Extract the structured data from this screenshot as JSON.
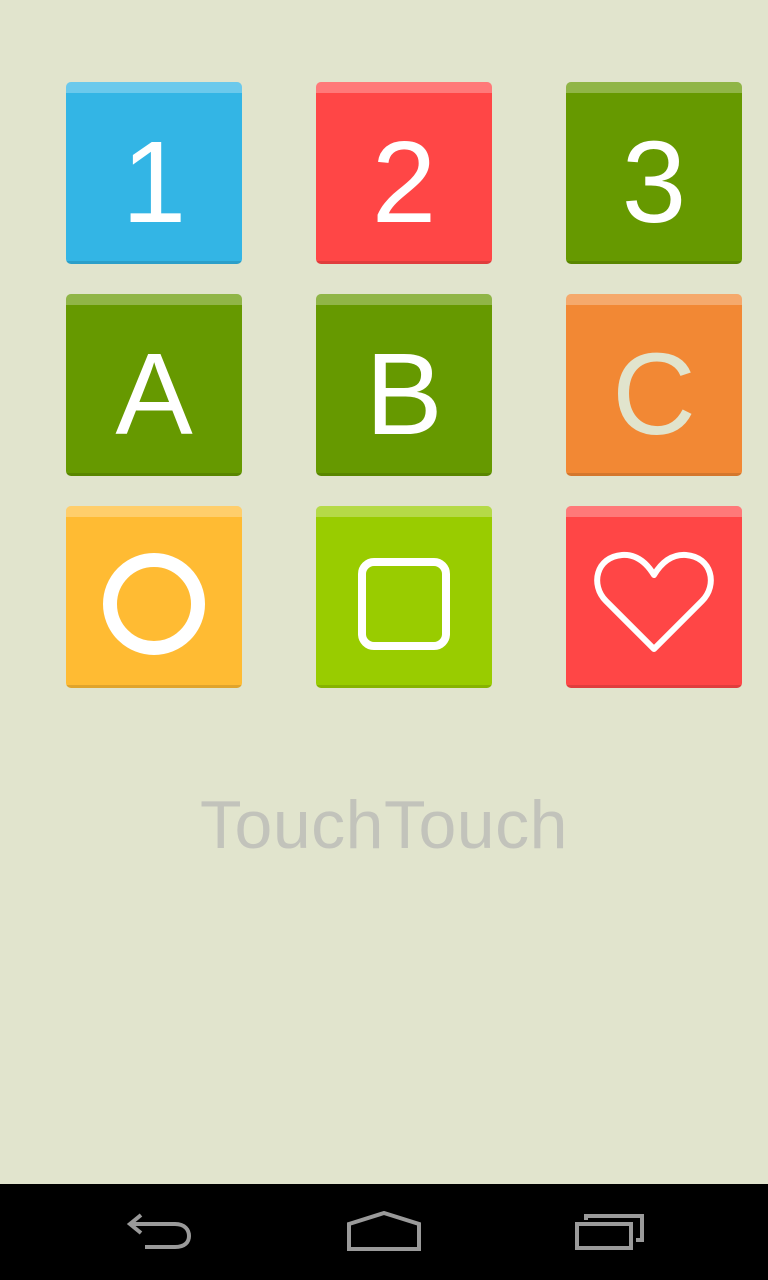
{
  "app": {
    "name": "TouchTouch"
  },
  "tiles": [
    {
      "label": "1",
      "color": "#33b5e5",
      "kind": "digit"
    },
    {
      "label": "2",
      "color": "#ff4646",
      "kind": "digit"
    },
    {
      "label": "3",
      "color": "#669900",
      "kind": "digit"
    },
    {
      "label": "A",
      "color": "#669900",
      "kind": "letter"
    },
    {
      "label": "B",
      "color": "#669900",
      "kind": "letter"
    },
    {
      "label": "C",
      "color": "#f28834",
      "kind": "letter",
      "text_color": "#e1e4cd"
    },
    {
      "icon": "circle-icon",
      "color": "#ffbb33",
      "kind": "shape"
    },
    {
      "icon": "square-icon",
      "color": "#99cc00",
      "kind": "shape"
    },
    {
      "icon": "heart-icon",
      "color": "#ff4646",
      "kind": "shape"
    }
  ],
  "navbar": {
    "back_icon": "back-icon",
    "home_icon": "home-icon",
    "recents_icon": "recents-icon",
    "background": "#000000"
  },
  "background": "#e1e4cd"
}
